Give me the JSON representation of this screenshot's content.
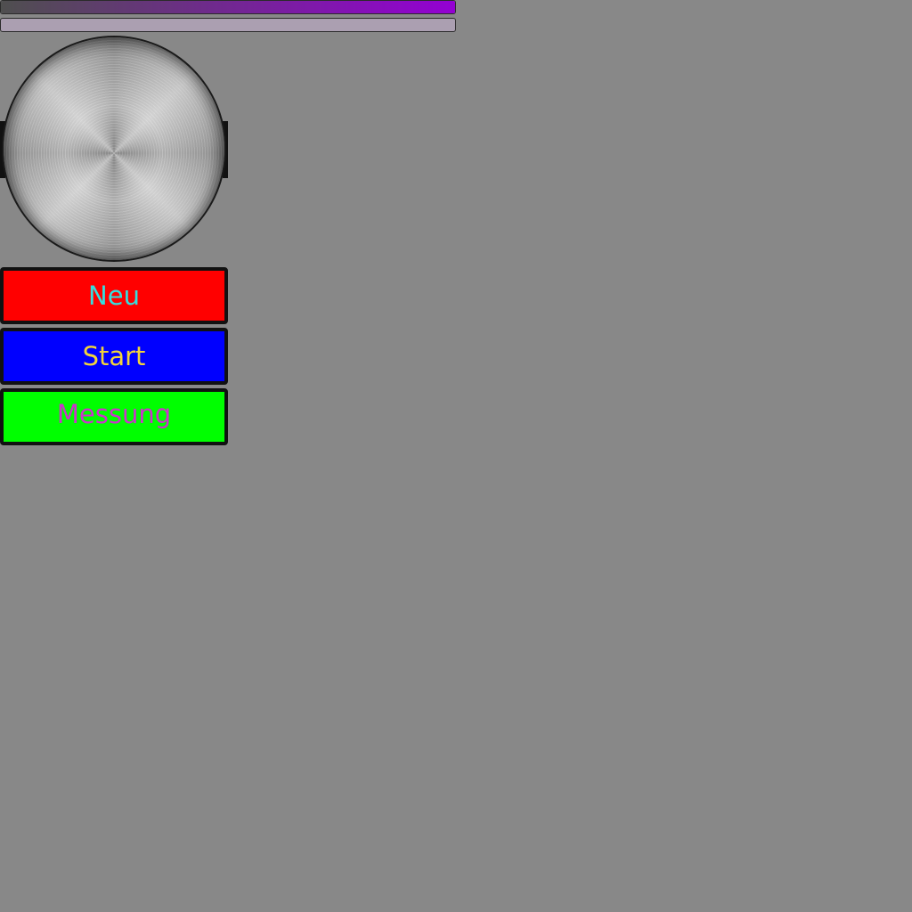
{
  "bars": [
    {
      "name": "progress-bar-top",
      "fill_fraction": 1.0,
      "gradient_from": "#4f4f4f",
      "gradient_to": "#9400d3",
      "track": "#ab9ab3"
    },
    {
      "name": "progress-bar-bottom",
      "fill_fraction": 0.0,
      "gradient_from": "#a89fae",
      "gradient_to": "#a89fae",
      "track": "#ab9fb1"
    }
  ],
  "knob": {
    "icon": "brushed-metal-dial-icon"
  },
  "buttons": {
    "neu": {
      "label": "Neu",
      "bg": "#ff0000",
      "fg": "#33e0e0"
    },
    "start": {
      "label": "Start",
      "bg": "#0000ff",
      "fg": "#f2d43a"
    },
    "messung": {
      "label": "Messung",
      "bg": "#00ff00",
      "fg": "#cc33cc"
    }
  },
  "colors": {
    "background": "#888888",
    "border": "#111111"
  }
}
